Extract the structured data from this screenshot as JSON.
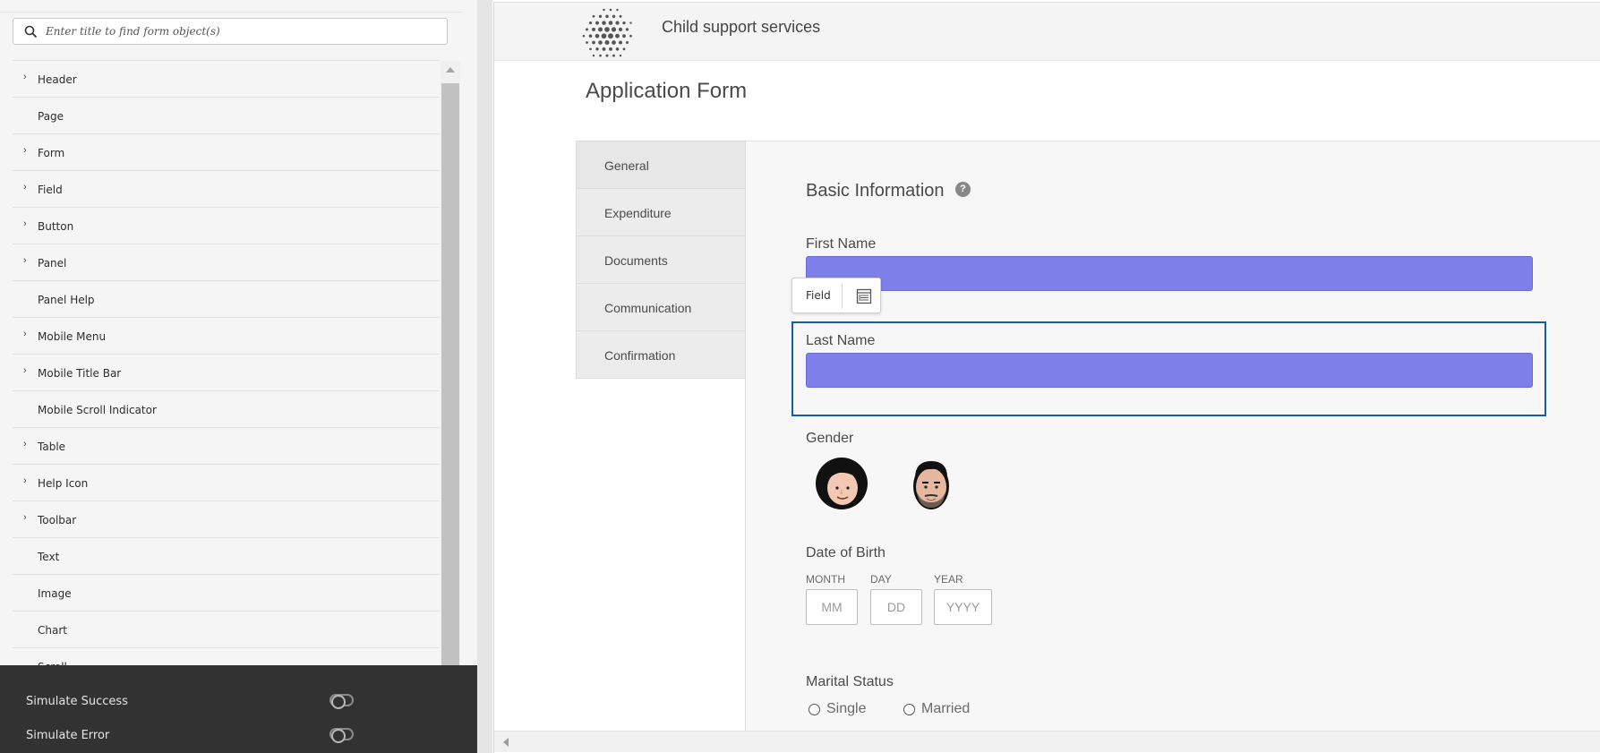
{
  "sidebar": {
    "search_placeholder": "Enter title to find form object(s)",
    "items": [
      {
        "label": "Header",
        "expandable": true
      },
      {
        "label": "Page",
        "expandable": false
      },
      {
        "label": "Form",
        "expandable": true
      },
      {
        "label": "Field",
        "expandable": true
      },
      {
        "label": "Button",
        "expandable": true
      },
      {
        "label": "Panel",
        "expandable": true
      },
      {
        "label": "Panel Help",
        "expandable": false
      },
      {
        "label": "Mobile Menu",
        "expandable": true
      },
      {
        "label": "Mobile Title Bar",
        "expandable": true
      },
      {
        "label": "Mobile Scroll Indicator",
        "expandable": false
      },
      {
        "label": "Table",
        "expandable": true
      },
      {
        "label": "Help Icon",
        "expandable": true
      },
      {
        "label": "Toolbar",
        "expandable": true
      },
      {
        "label": "Text",
        "expandable": false
      },
      {
        "label": "Image",
        "expandable": false
      },
      {
        "label": "Chart",
        "expandable": false
      },
      {
        "label": "Scroll...",
        "expandable": false
      }
    ],
    "simulate_success": "Simulate Success",
    "simulate_error": "Simulate Error"
  },
  "form": {
    "site_title": "Child support services",
    "title": "Application Form",
    "tabs": [
      "General",
      "Expenditure",
      "Documents",
      "Communication",
      "Confirmation"
    ],
    "section_title": "Basic Information",
    "help_icon": "?",
    "first_name_label": "First Name",
    "last_name_label": "Last Name",
    "tooltip_label": "Field",
    "gender_label": "Gender",
    "dob_label": "Date of Birth",
    "dob": {
      "month_label": "MONTH",
      "day_label": "DAY",
      "year_label": "YEAR",
      "month_placeholder": "MM",
      "day_placeholder": "DD",
      "year_placeholder": "YYYY"
    },
    "marital_label": "Marital Status",
    "marital_options": [
      "Single",
      "Married"
    ]
  },
  "colors": {
    "field_fill": "#7f7fe9",
    "selection_border": "#1b5aa5",
    "sim_panel_bg": "#323232"
  }
}
